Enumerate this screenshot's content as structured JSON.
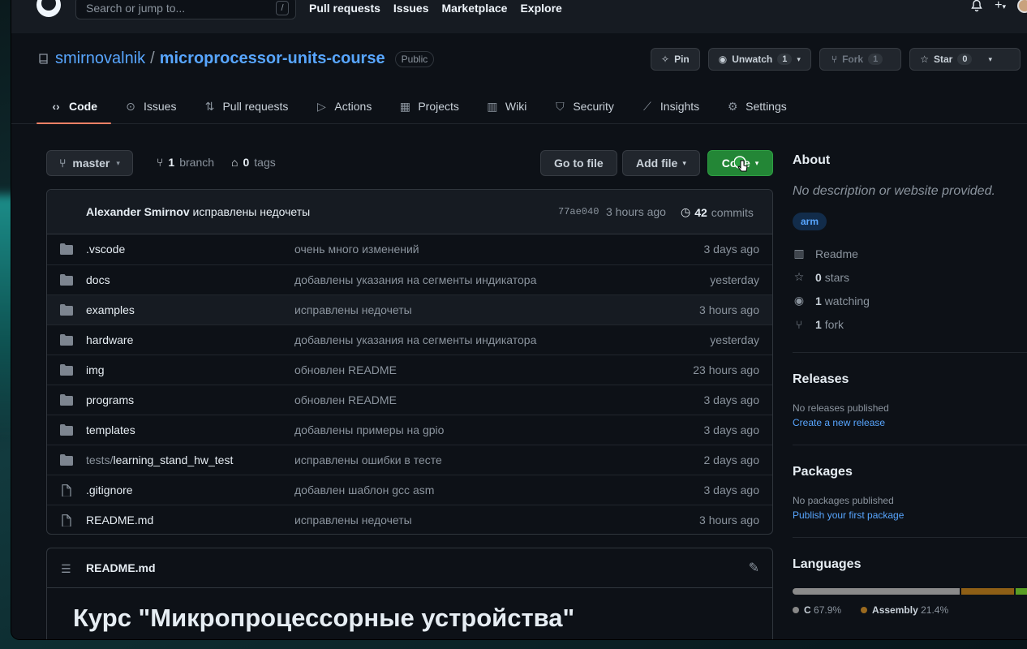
{
  "header": {
    "search_placeholder": "Search or jump to...",
    "search_key": "/",
    "nav": [
      "Pull requests",
      "Issues",
      "Marketplace",
      "Explore"
    ]
  },
  "repo": {
    "owner": "smirnovalnik",
    "separator": "/",
    "name": "microprocessor-units-course",
    "visibility": "Public",
    "actions": {
      "pin": "Pin",
      "unwatch": "Unwatch",
      "watch_count": "1",
      "fork": "Fork",
      "fork_count": "1",
      "star": "Star",
      "star_count": "0"
    },
    "tabs": [
      {
        "label": "Code",
        "icon": "code-icon"
      },
      {
        "label": "Issues",
        "icon": "issue-icon"
      },
      {
        "label": "Pull requests",
        "icon": "pull-request-icon"
      },
      {
        "label": "Actions",
        "icon": "play-icon"
      },
      {
        "label": "Projects",
        "icon": "table-icon"
      },
      {
        "label": "Wiki",
        "icon": "book-icon"
      },
      {
        "label": "Security",
        "icon": "shield-icon"
      },
      {
        "label": "Insights",
        "icon": "graph-icon"
      },
      {
        "label": "Settings",
        "icon": "gear-icon"
      }
    ]
  },
  "branchbar": {
    "branch": "master",
    "branch_count": "1",
    "branch_label": "branch",
    "tag_count": "0",
    "tag_label": "tags",
    "go_to_file": "Go to file",
    "add_file": "Add file",
    "code": "Code"
  },
  "commit": {
    "author": "Alexander Smirnov",
    "message": "исправлены недочеты",
    "sha": "77ae040",
    "time": "3 hours ago",
    "count": "42",
    "count_label": "commits"
  },
  "files": [
    {
      "type": "dir",
      "name": ".vscode",
      "message": "очень много изменений",
      "date": "3 days ago"
    },
    {
      "type": "dir",
      "name": "docs",
      "message": "добавлены указания на сегменты индикатора",
      "date": "yesterday"
    },
    {
      "type": "dir",
      "name": "examples",
      "message": "исправлены недочеты",
      "date": "3 hours ago"
    },
    {
      "type": "dir",
      "name": "hardware",
      "message": "добавлены указания на сегменты индикатора",
      "date": "yesterday"
    },
    {
      "type": "dir",
      "name": "img",
      "message": "обновлен README",
      "date": "23 hours ago"
    },
    {
      "type": "dir",
      "name": "programs",
      "message": "обновлен README",
      "date": "3 days ago"
    },
    {
      "type": "dir",
      "name": "templates",
      "message": "добавлены примеры на gpio",
      "date": "3 days ago"
    },
    {
      "type": "dir",
      "prefix": "tests/",
      "name": "learning_stand_hw_test",
      "message": "исправлены ошибки в тесте",
      "date": "2 days ago"
    },
    {
      "type": "file",
      "name": ".gitignore",
      "message": "добавлен шаблон gcc asm",
      "date": "3 days ago"
    },
    {
      "type": "file",
      "name": "README.md",
      "message": "исправлены недочеты",
      "date": "3 hours ago"
    }
  ],
  "readme": {
    "filename": "README.md",
    "heading": "Курс \"Микропроцессорные устройства\""
  },
  "sidebar": {
    "about_title": "About",
    "about_desc": "No description or website provided.",
    "topic": "arm",
    "readme": "Readme",
    "stars_count": "0",
    "stars_label": "stars",
    "watching_count": "1",
    "watching_label": "watching",
    "fork_count": "1",
    "fork_label": "fork",
    "releases_title": "Releases",
    "releases_none": "No releases published",
    "releases_link": "Create a new release",
    "packages_title": "Packages",
    "packages_none": "No packages published",
    "packages_link": "Publish your first package",
    "languages_title": "Languages",
    "languages": [
      {
        "name": "C",
        "percent": "67.9%",
        "value": 67.9,
        "color": "#555555"
      },
      {
        "name": "Assembly",
        "percent": "21.4%",
        "value": 21.4,
        "color": "#6E4C13"
      },
      {
        "name": "",
        "percent": "",
        "value": 10.7,
        "color": "#4e9a26"
      }
    ]
  },
  "colors": {
    "accent": "#58a6ff",
    "green": "#238636",
    "tab_underline": "#f78166"
  }
}
